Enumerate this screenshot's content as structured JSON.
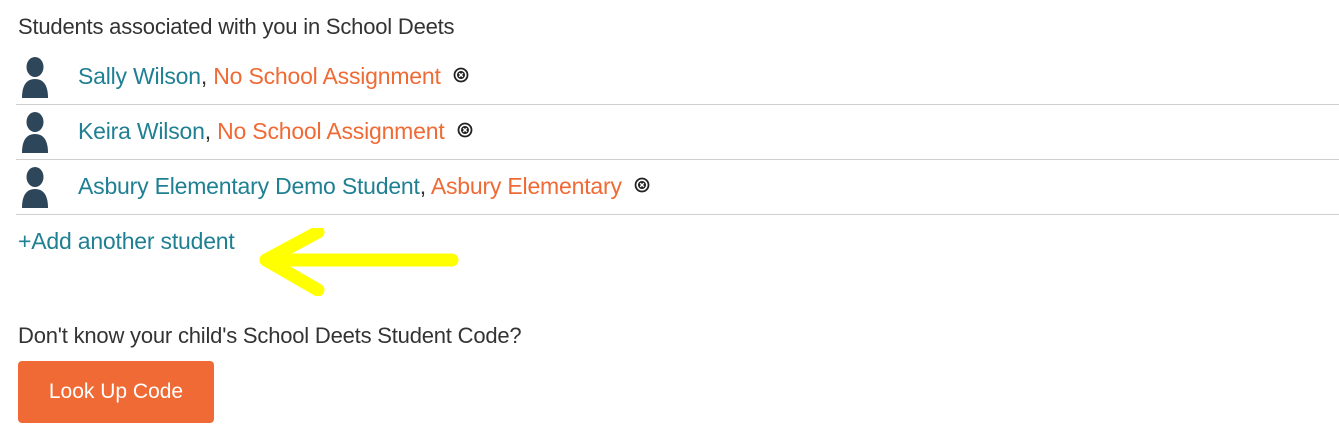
{
  "heading": "Students associated with you in School Deets",
  "students": [
    {
      "name": "Sally Wilson",
      "separator": ",",
      "school": "No School Assignment"
    },
    {
      "name": "Keira Wilson",
      "separator": ",",
      "school": "No School Assignment"
    },
    {
      "name": "Asbury Elementary Demo Student",
      "separator": ",",
      "school": "Asbury Elementary"
    }
  ],
  "add_link": "+Add another student",
  "lookup": {
    "prompt": "Don't know your child's School Deets Student Code?",
    "button_label": "Look Up Code"
  },
  "colors": {
    "link": "#1f7f93",
    "school": "#ef6a34",
    "button": "#ef6a34",
    "avatar": "#2e4659",
    "annotation_arrow": "#ffff00"
  },
  "icons": {
    "avatar": "person-silhouette-icon",
    "remove": "circle-x-icon",
    "annotation": "yellow-arrow-left-icon"
  }
}
